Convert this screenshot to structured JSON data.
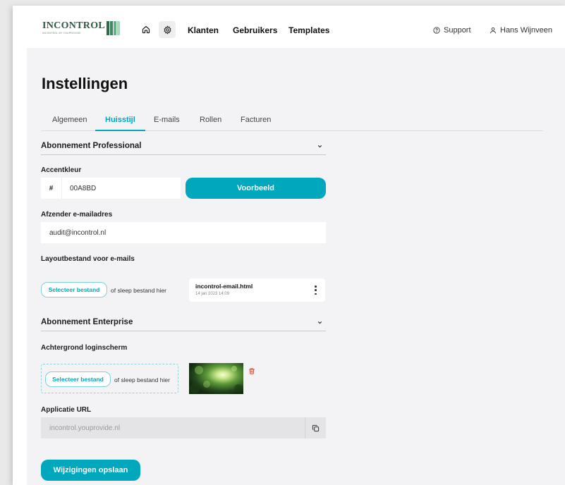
{
  "nav": {
    "logo_text": "INCONTROL",
    "logo_subtitle": "INCONTROL BY YOUPROVIDE",
    "links": [
      "Klanten",
      "Gebruikers",
      "Templates"
    ],
    "support": "Support",
    "user": "Hans Wijnveen",
    "icons": {
      "home": "home-icon",
      "settings": "gear-icon",
      "support": "help-circle-icon",
      "user": "user-icon"
    }
  },
  "page": {
    "title": "Instellingen"
  },
  "tabs": [
    "Algemeen",
    "Huisstijl",
    "E-mails",
    "Rollen",
    "Facturen"
  ],
  "active_tab": "Huisstijl",
  "professional": {
    "title": "Abonnement Professional",
    "accent_label": "Accentkleur",
    "hash": "#",
    "accent_value": "00A8BD",
    "preview_button": "Voorbeeld",
    "sender_label": "Afzender e-mailadres",
    "sender_value": "audit@incontrol.nl",
    "layout_label": "Layoutbestand voor e-mails",
    "select_button": "Selecteer bestand",
    "drop_hint": "of sleep bestand hier",
    "file_name": "incontrol-email.html",
    "file_date": "14 jan 2023 14:09"
  },
  "enterprise": {
    "title": "Abonnement Enterprise",
    "bg_label": "Achtergrond loginscherm",
    "select_button": "Selecteer bestand",
    "drop_hint": "of sleep bestand hier",
    "url_label": "Applicatie URL",
    "url_value": "incontrol.youprovide.nl"
  },
  "save_button": "Wijzigingen opslaan",
  "colors": {
    "accent": "#00A8BD",
    "logo_green": "#2f5b46",
    "logo_bars": [
      "#2f6b4a",
      "#3e8a60",
      "#66b588",
      "#a9d8b8"
    ],
    "danger": "#e0453a"
  }
}
